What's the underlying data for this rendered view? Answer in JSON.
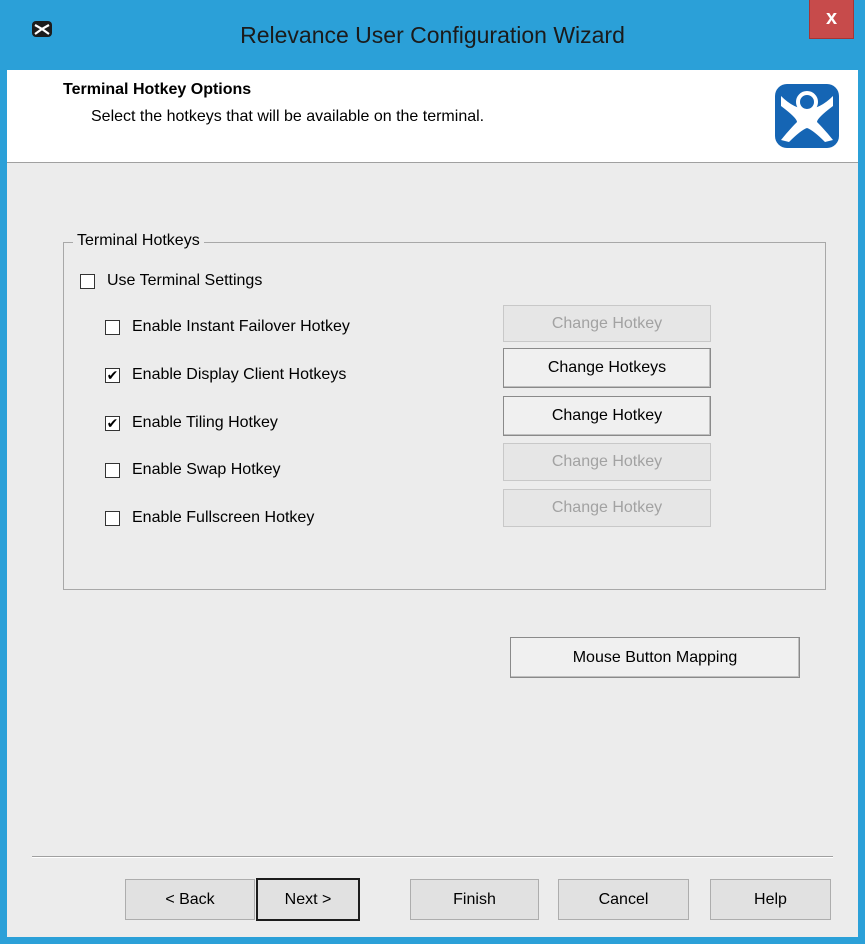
{
  "window": {
    "title": "Relevance User Configuration Wizard",
    "close_label": "x"
  },
  "header": {
    "title": "Terminal Hotkey Options",
    "subtitle": "Select the hotkeys that will be available on the terminal.",
    "logo_icon": "wizard-logo-icon"
  },
  "group": {
    "legend": "Terminal Hotkeys",
    "use_terminal_settings": {
      "label": "Use Terminal Settings",
      "checked": false
    },
    "items": [
      {
        "label": "Enable Instant Failover Hotkey",
        "checked": false,
        "button": "Change Hotkey",
        "button_enabled": false
      },
      {
        "label": "Enable Display Client Hotkeys",
        "checked": true,
        "button": "Change Hotkeys",
        "button_enabled": true
      },
      {
        "label": "Enable Tiling Hotkey",
        "checked": true,
        "button": "Change Hotkey",
        "button_enabled": true
      },
      {
        "label": "Enable Swap Hotkey",
        "checked": false,
        "button": "Change Hotkey",
        "button_enabled": false
      },
      {
        "label": "Enable Fullscreen Hotkey",
        "checked": false,
        "button": "Change Hotkey",
        "button_enabled": false
      }
    ]
  },
  "mouse_button_mapping": "Mouse Button Mapping",
  "footer": {
    "back": "< Back",
    "next": "Next >",
    "finish": "Finish",
    "cancel": "Cancel",
    "help": "Help"
  },
  "colors": {
    "titlebar": "#2ba0d8",
    "close": "#c74b4b"
  }
}
